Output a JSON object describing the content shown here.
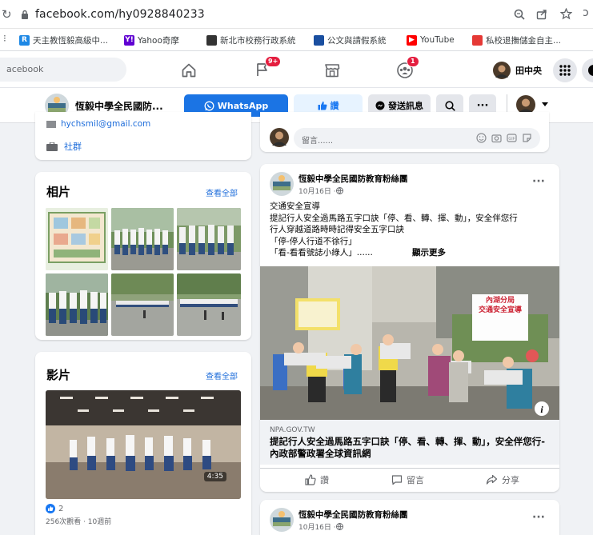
{
  "browser": {
    "url": "facebook.com/hy0928840233",
    "bookmarks": [
      {
        "label": "天主教恆毅高級中...",
        "icon_text": "R",
        "color": "#1e88e5"
      },
      {
        "label": "Yahoo奇摩",
        "icon_text": "Y!",
        "color": "#6001d2"
      },
      {
        "label": "新北市校務行政系統",
        "icon_text": "",
        "color": "#333333"
      },
      {
        "label": "公文與請假系統",
        "icon_text": "",
        "color": "#1a4fa0"
      },
      {
        "label": "YouTube",
        "icon_text": "▶",
        "color": "#ff0000"
      },
      {
        "label": "私校退撫儲金自主...",
        "icon_text": "",
        "color": "#e53935"
      }
    ]
  },
  "fb": {
    "search_placeholder": "acebook",
    "flag_badge": "9+",
    "groups_badge": "1",
    "user_name": "田中央"
  },
  "page_header": {
    "page_name": "恆毅中學全民國防...",
    "whatsapp_label": "WhatsApp",
    "like_label": "讚",
    "message_label": "發送訊息"
  },
  "about": {
    "email_partial": "hychsmil@gmail.com",
    "category": "社群"
  },
  "photos": {
    "title": "相片",
    "see_all": "查看全部"
  },
  "videos": {
    "title": "影片",
    "see_all": "查看全部",
    "duration": "4:35",
    "reactions": "2",
    "views": "256次觀看 · 10週前"
  },
  "composer": {
    "placeholder": "留言......"
  },
  "post1": {
    "author": "恆毅中學全民國防教育粉絲團",
    "date": "10月16日 · ",
    "text_lines": [
      "交通安全宣導",
      "提記行人安全過馬路五字口訣「停、看、轉、揮、動」，安全伴您行",
      "行人穿越道路時時記得安全五字口訣",
      "「停-停人行道不徐行」",
      "「看-看看號誌小綠人」......"
    ],
    "see_more": "顯示更多",
    "link_domain": "NPA.GOV.TW",
    "link_title": "提記行人安全過馬路五字口訣「停、看、轉、揮、動」，安全伴您行-內政部警政署全球資訊網",
    "sign_text": "內湖分局\n交通安全宣導",
    "like_action": "讚",
    "comment_action": "留言",
    "share_action": "分享"
  },
  "post2": {
    "author": "恆毅中學全民國防教育粉絲團",
    "date": "10月16日 · "
  },
  "colors": {
    "fb_blue": "#1877f2",
    "whatsapp": "#1b74e4",
    "link": "#216fdb",
    "badge_red": "#e41e3f"
  }
}
